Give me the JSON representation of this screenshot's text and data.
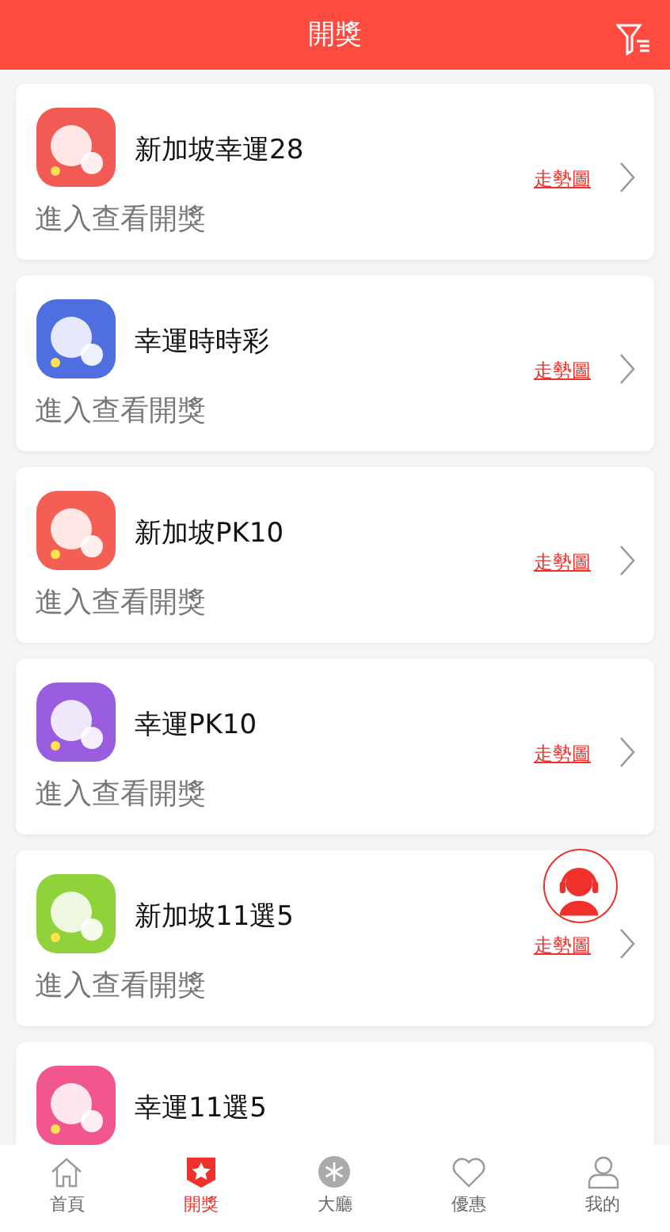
{
  "header": {
    "title": "開獎"
  },
  "lotteries": [
    {
      "name": "新加坡幸運28",
      "subtitle": "進入查看開獎",
      "trend_link": "走勢圖",
      "color": "#f25a55"
    },
    {
      "name": "幸運時時彩",
      "subtitle": "進入查看開獎",
      "trend_link": "走勢圖",
      "color": "#4f6fe0"
    },
    {
      "name": "新加坡PK10",
      "subtitle": "進入查看開獎",
      "trend_link": "走勢圖",
      "color": "#f45f55"
    },
    {
      "name": "幸運PK10",
      "subtitle": "進入查看開獎",
      "trend_link": "走勢圖",
      "color": "#9a5de0"
    },
    {
      "name": "新加坡11選5",
      "subtitle": "進入查看開獎",
      "trend_link": "走勢圖",
      "color": "#8fd23a"
    },
    {
      "name": "幸運11選5",
      "color": "#f2568f"
    }
  ],
  "tab_bar": [
    {
      "label": "首頁",
      "kind": "home",
      "selected": false
    },
    {
      "label": "開獎",
      "kind": "star",
      "selected": true
    },
    {
      "label": "大廳",
      "kind": "lobby",
      "selected": false
    },
    {
      "label": "優惠",
      "kind": "heart",
      "selected": false
    },
    {
      "label": "我的",
      "kind": "person",
      "selected": false
    }
  ]
}
